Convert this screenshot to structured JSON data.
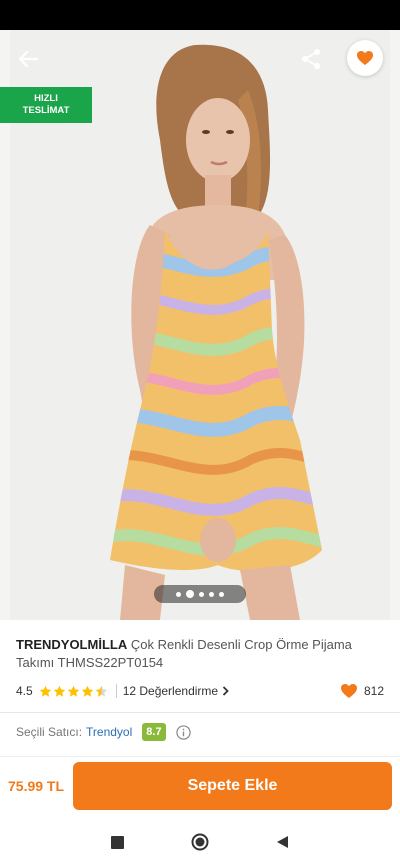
{
  "product": {
    "brand": "TRENDYOLMİLLA",
    "name": "Çok Renkli Desenli Crop Örme Pijama Takımı THMSS22PT0154",
    "rating": "4.5",
    "rating_value": 4.5,
    "reviews_label": "12 Değerlendirme",
    "favorites": "812"
  },
  "badge": {
    "line1": "HIZLI",
    "line2": "TESLİMAT"
  },
  "gallery": {
    "count": 5,
    "active_index": 1
  },
  "seller": {
    "label": "Seçili Satıcı:",
    "name": "Trendyol",
    "score": "8.7"
  },
  "purchase": {
    "price": "75.99 TL",
    "cart_label": "Sepete Ekle"
  },
  "colors": {
    "accent": "#f27a1a",
    "badge_green": "#1aa54a",
    "score_green": "#8bb93a",
    "seller_blue": "#2d6fb5"
  },
  "icons": [
    "back-arrow-icon",
    "share-icon",
    "heart-icon",
    "star-icon",
    "chevron-right-icon",
    "info-icon",
    "square-nav-icon",
    "circle-nav-icon",
    "triangle-nav-icon"
  ]
}
